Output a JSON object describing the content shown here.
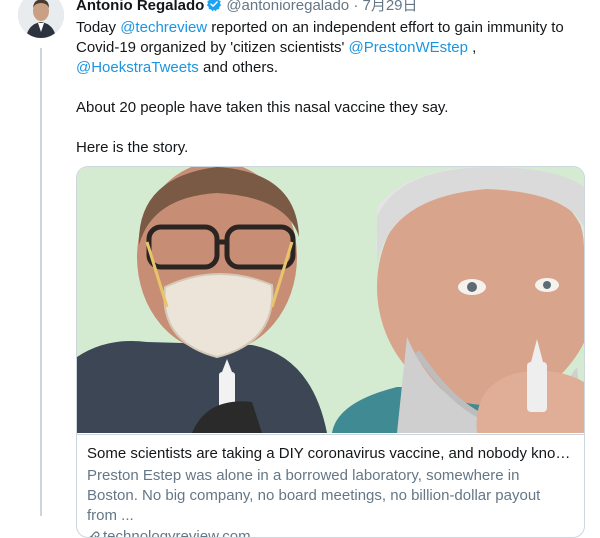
{
  "tweet": {
    "author": {
      "display_name": "Antonio Regalado",
      "handle": "@antonioregalado",
      "separator": "·",
      "date": "7月29日",
      "verified": true
    },
    "text": {
      "line1_prefix": "Today ",
      "mention_techreview": "@techreview",
      "line1_middle": " reported on an independent effort to gain immunity to Covid-19 organized by 'citizen scientists' ",
      "mention_prestonwestep": "@PrestonWEstep",
      "line1_comma": " ,",
      "mention_hoekstratweets": "@HoekstraTweets",
      "line1_suffix": " and others.",
      "paragraph2": "About 20 people have taken this nasal vaccine they say.",
      "paragraph3": "Here is the story."
    },
    "card": {
      "title": "Some scientists are taking a DIY coronavirus vaccine, and nobody knows...",
      "description": "Preston Estep was alone in a borrowed laboratory, somewhere in Boston. No big company, no board meetings, no billion-dollar payout from ...",
      "domain": "technologyreview.com"
    }
  },
  "colors": {
    "link": "#1b95e0",
    "verified": "#1da1f2",
    "secondary_text": "#657786",
    "primary_text": "#14171a",
    "border": "#ccd6dd",
    "image_background": "#cfe8cf"
  }
}
